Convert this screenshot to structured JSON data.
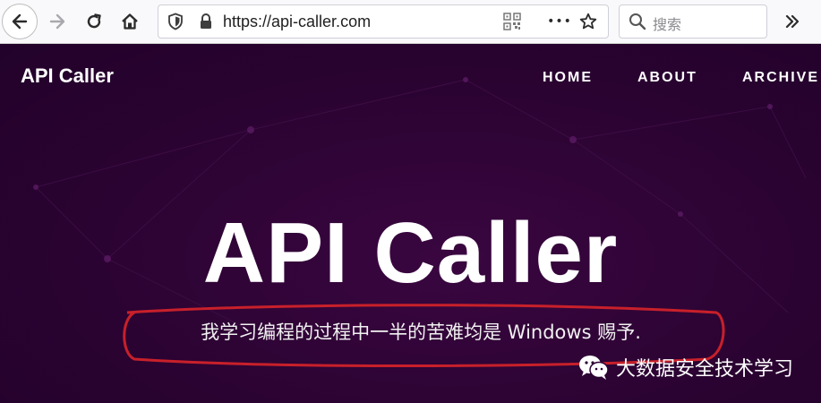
{
  "browser": {
    "url": "https://api-caller.com",
    "search_placeholder": "搜索",
    "menu_dots": "•••"
  },
  "site": {
    "brand": "API Caller",
    "nav": [
      {
        "label": "HOME"
      },
      {
        "label": "ABOUT"
      },
      {
        "label": "ARCHIVE"
      }
    ],
    "hero_title": "API Caller",
    "subtitle": "我学习编程的过程中一半的苦难均是 Windows 赐予."
  },
  "watermark": {
    "text": "大数据安全技术学习",
    "icon": "wechat-icon"
  },
  "colors": {
    "background": "#2b0332",
    "annotation": "#c8202a",
    "text": "#ffffff"
  }
}
